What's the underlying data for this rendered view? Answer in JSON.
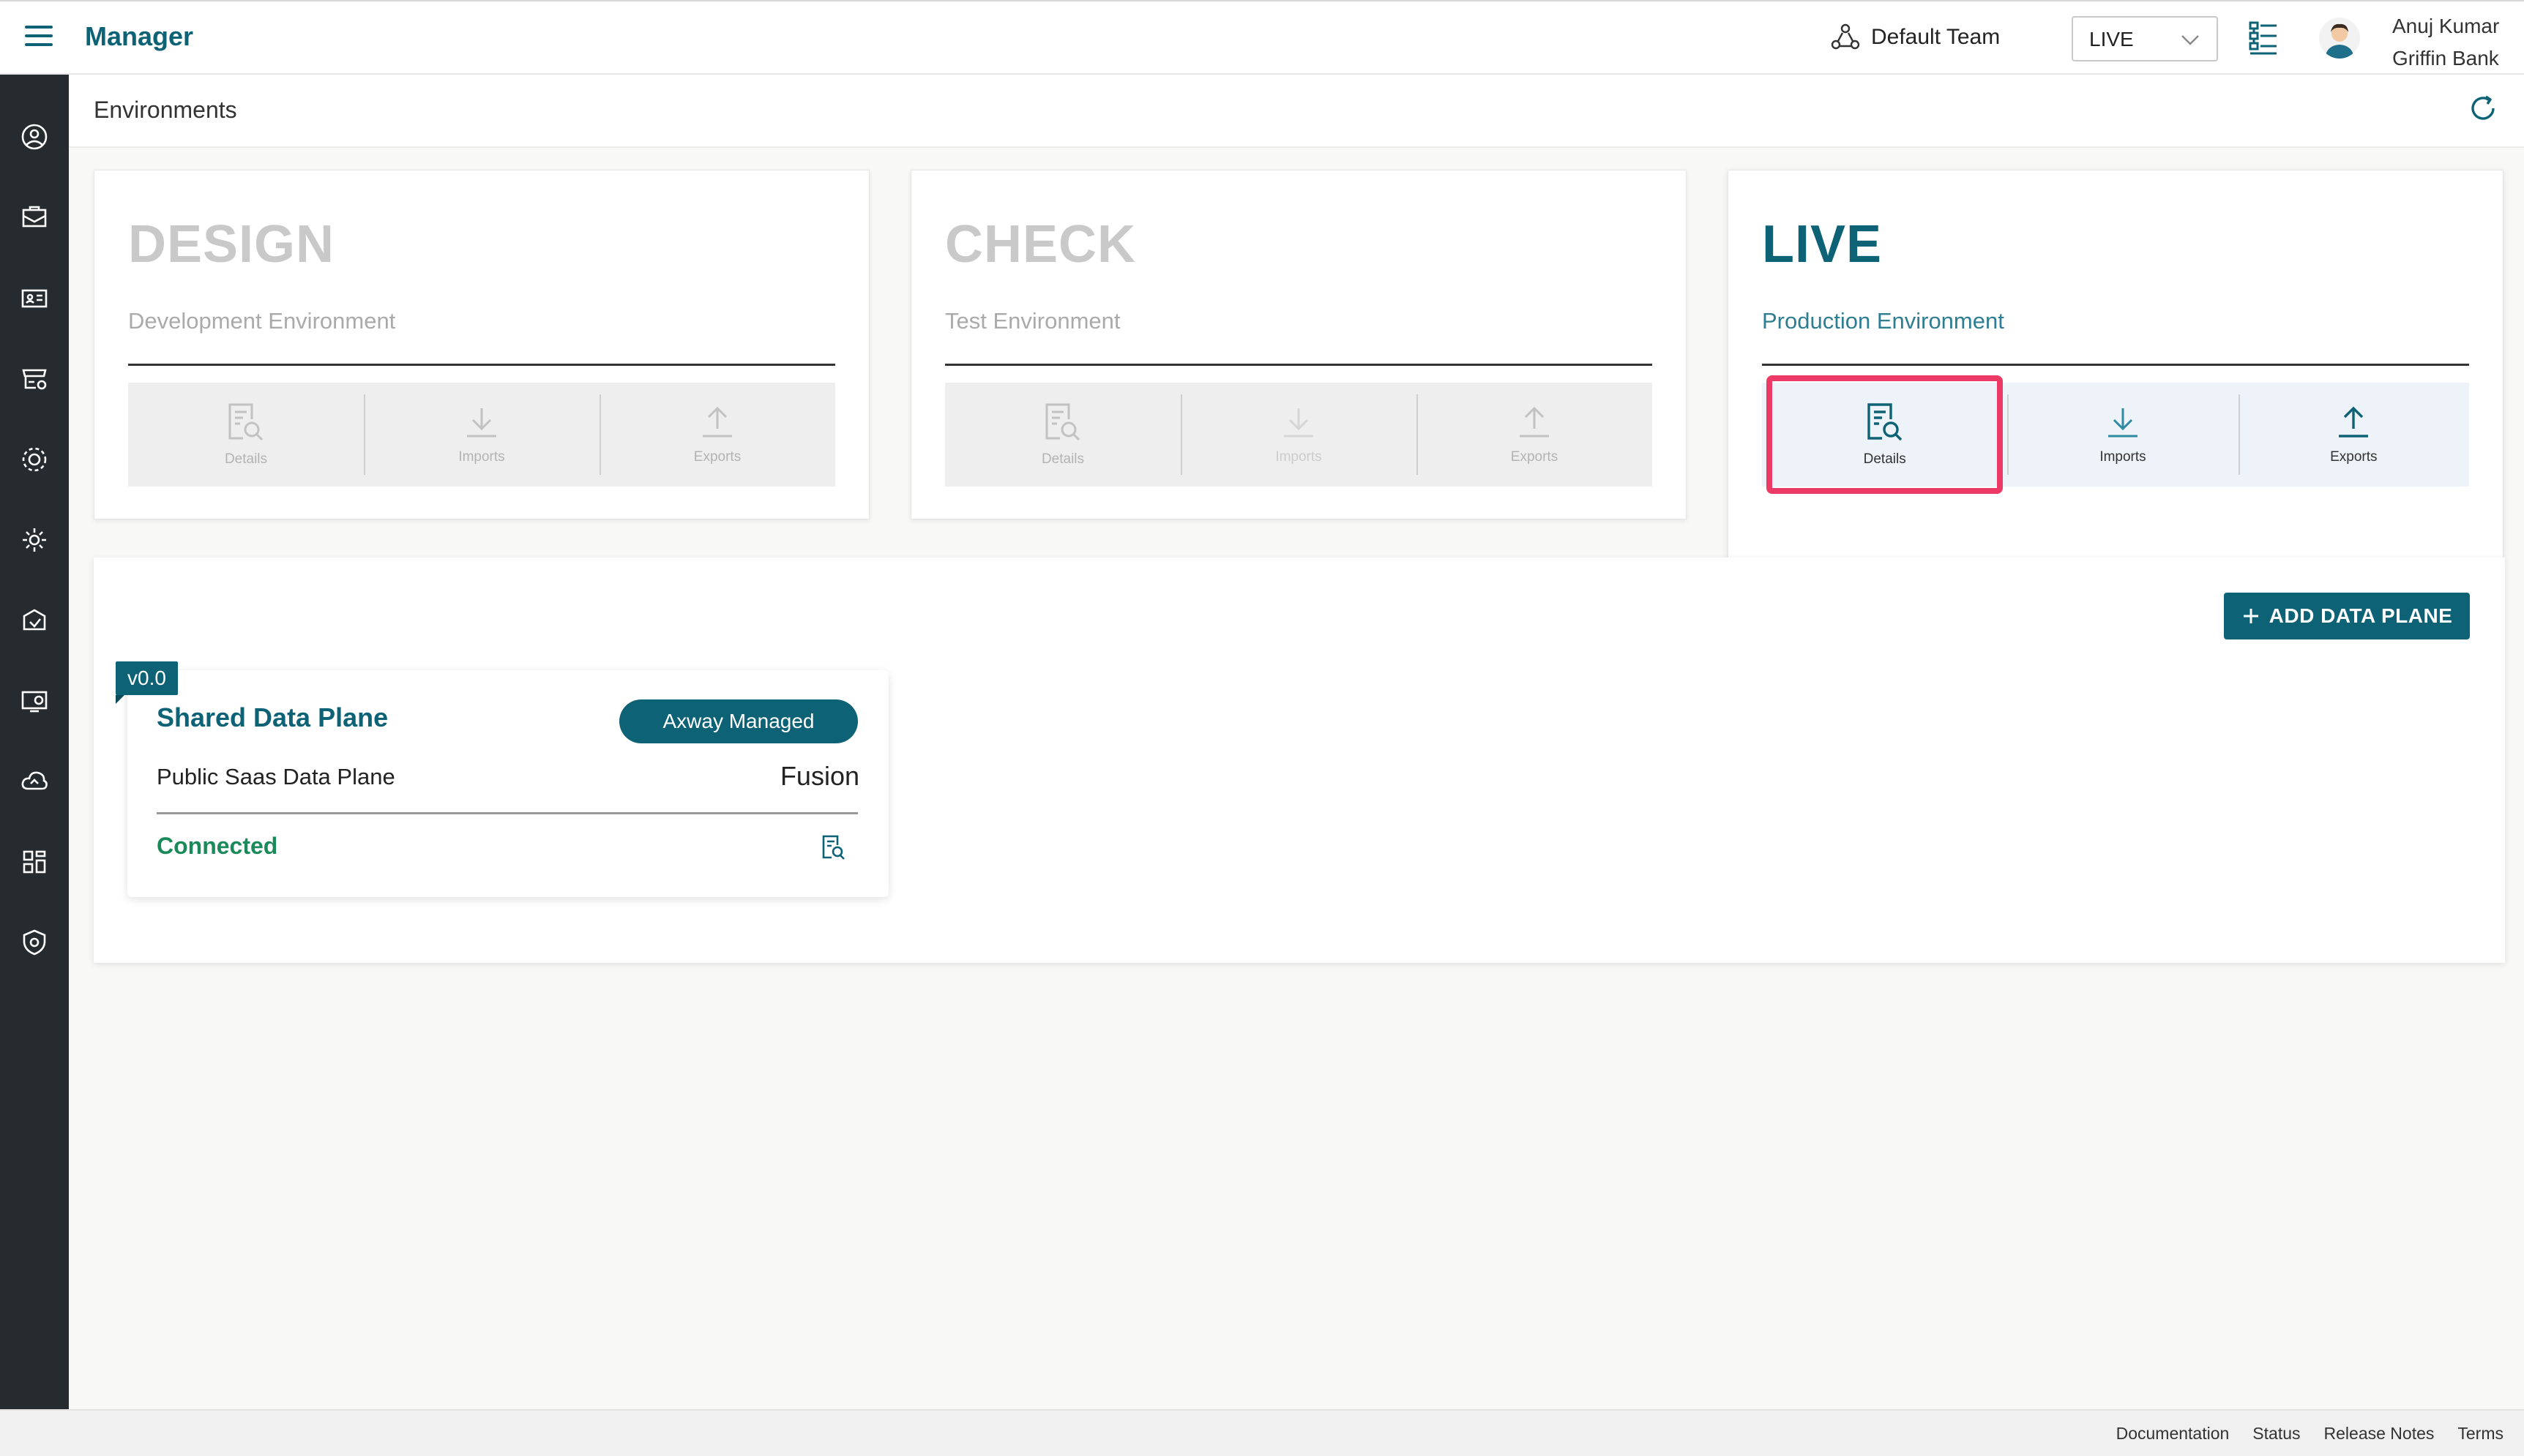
{
  "app": {
    "title": "Manager"
  },
  "header": {
    "team": "Default Team",
    "environment_select": "LIVE",
    "user_name": "Anuj Kumar",
    "org_name": "Griffin Bank"
  },
  "page": {
    "title": "Environments"
  },
  "environments": [
    {
      "name": "DESIGN",
      "subtitle": "Development Environment",
      "actions": [
        "Details",
        "Imports",
        "Exports"
      ]
    },
    {
      "name": "CHECK",
      "subtitle": "Test Environment",
      "actions": [
        "Details",
        "Imports",
        "Exports"
      ]
    },
    {
      "name": "LIVE",
      "subtitle": "Production Environment",
      "actions": [
        "Details",
        "Imports",
        "Exports"
      ]
    }
  ],
  "data_planes": {
    "add_button": "ADD DATA PLANE",
    "items": [
      {
        "version": "v0.0",
        "title": "Shared Data Plane",
        "badge": "Axway Managed",
        "description": "Public Saas Data Plane",
        "type": "Fusion",
        "status": "Connected"
      }
    ]
  },
  "footer": {
    "links": [
      "Documentation",
      "Status",
      "Release Notes",
      "Terms"
    ]
  },
  "colors": {
    "brand": "#0e6276",
    "connected": "#1a8a5a",
    "highlight": "#ea3a65",
    "sidebar": "#262b2f"
  }
}
